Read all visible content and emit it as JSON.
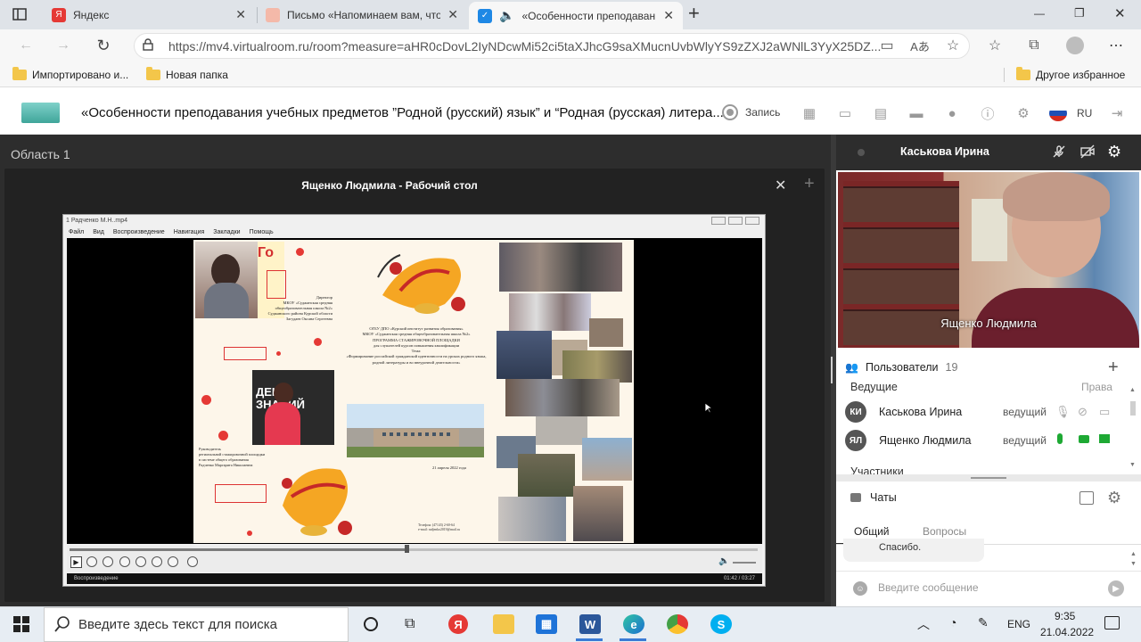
{
  "tabs": [
    {
      "title": "Яндекс",
      "close": "✕"
    },
    {
      "title": "Письмо «Напоминаем вам, что",
      "close": "✕"
    },
    {
      "title": "«Особенности преподаван",
      "close": "✕"
    }
  ],
  "new_tab": "+",
  "window": {
    "min": "—",
    "restore": "❐",
    "close": "✕"
  },
  "address": {
    "url": "https://mv4.virtualroom.ru/room?measure=aHR0cDovL2IyNDcwMi52ci5taXJhcG9saXMucnUvbWlyYS9zZXJ2aWNlL3YyX25DZ..."
  },
  "bookmarks": [
    {
      "label": "Импортировано и..."
    },
    {
      "label": "Новая папка"
    },
    {
      "label": "Другое избранное"
    }
  ],
  "app": {
    "title": "«Особенности преподавания учебных предметов ”Родной (русский) язык” и “Родная (русская) литера...",
    "record_label": "Запись",
    "language": "RU"
  },
  "workspace": {
    "area_title": "Область 1",
    "panel_title": "Ященко Людмила - Рабочий стол",
    "close": "✕",
    "add": "+"
  },
  "player": {
    "title": "1 Радченко М.Н..mp4",
    "menu": [
      "Файл",
      "Вид",
      "Воспроизведение",
      "Навигация",
      "Закладки",
      "Помощь"
    ],
    "status_label": "Воспроизведение",
    "time": "01:42 / 03:27",
    "progress": 0.49
  },
  "slide": {
    "director_text": "Директор\nМКОУ «Суджанская средняя общеобразовательная школа №2» Суджанского района Курской области\nЗагудаев Оксана Сергеевна",
    "program_text": "ОГБУ ДПО «Курский институт развития образования»\nМКОУ «Суджанская средняя общеобразовательная школа №2»\nПРОГРАММА СТАЖИРОВОЧНОЙ ПЛОЩАДКИ\nдля слушателей курсов повышения квалификации\nТема:\n«Формирование российской гражданской идентичности на уроках родного языка, родной литературы и во внеурочной деятельности»",
    "date_text": "21 апреля 2022 года",
    "leader_text": "Руководитель\nрегиональной стажировочной площадки\nв системе общего образования\nРадченко Маргарита Николаевна",
    "contact_text": "Телефон: (47143) 2-60-64\ne-mail: radjenko2019@mail.ru",
    "board_text": "ДЕНЬ ЗНАНИЙ"
  },
  "right": {
    "speaker_name": "Каськова Ирина",
    "camera_name": "Ященко Людмила",
    "users_label": "Пользователи",
    "users_count": "19",
    "hosts_label": "Ведущие",
    "rights_label": "Права",
    "participants_label": "Участники",
    "users": [
      {
        "initials": "КИ",
        "name": "Каськова Ирина",
        "role": "ведущий"
      },
      {
        "initials": "ЯЛ",
        "name": "Ященко Людмила",
        "role": "ведущий"
      }
    ],
    "chats_label": "Чаты",
    "chat_tabs": [
      "Общий",
      "Вопросы"
    ],
    "last_message": "Спасибо.",
    "message_placeholder": "Введите сообщение"
  },
  "taskbar": {
    "search_placeholder": "Введите здесь текст для поиска",
    "lang": "ENG",
    "time": "9:35",
    "date": "21.04.2022"
  },
  "colors": {
    "dark_bg": "#2d2d2d",
    "accent": "#2e7d32",
    "taskbar": "#e7edf3"
  }
}
